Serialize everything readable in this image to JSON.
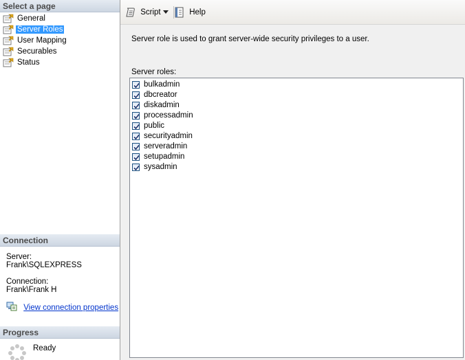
{
  "left": {
    "select_page_header": "Select a page",
    "pages": [
      {
        "label": "General"
      },
      {
        "label": "Server Roles",
        "selected": true
      },
      {
        "label": "User Mapping"
      },
      {
        "label": "Securables"
      },
      {
        "label": "Status"
      }
    ],
    "connection": {
      "header": "Connection",
      "server_label": "Server:",
      "server_value": "Frank\\SQLEXPRESS",
      "connection_label": "Connection:",
      "connection_value": "Frank\\Frank H",
      "view_link": "View connection properties"
    },
    "progress": {
      "header": "Progress",
      "status": "Ready"
    }
  },
  "toolbar": {
    "script_label": "Script",
    "help_label": "Help"
  },
  "main": {
    "description": "Server role is used to grant server-wide security privileges to a user.",
    "roles_label": "Server roles:",
    "roles": [
      {
        "name": "bulkadmin",
        "checked": true
      },
      {
        "name": "dbcreator",
        "checked": true
      },
      {
        "name": "diskadmin",
        "checked": true
      },
      {
        "name": "processadmin",
        "checked": true
      },
      {
        "name": "public",
        "checked": true
      },
      {
        "name": "securityadmin",
        "checked": true
      },
      {
        "name": "serveradmin",
        "checked": true
      },
      {
        "name": "setupadmin",
        "checked": true
      },
      {
        "name": "sysadmin",
        "checked": true
      }
    ]
  },
  "colors": {
    "selection": "#3399ff",
    "link": "#0033cc",
    "section_header": "#cdd6e2"
  }
}
